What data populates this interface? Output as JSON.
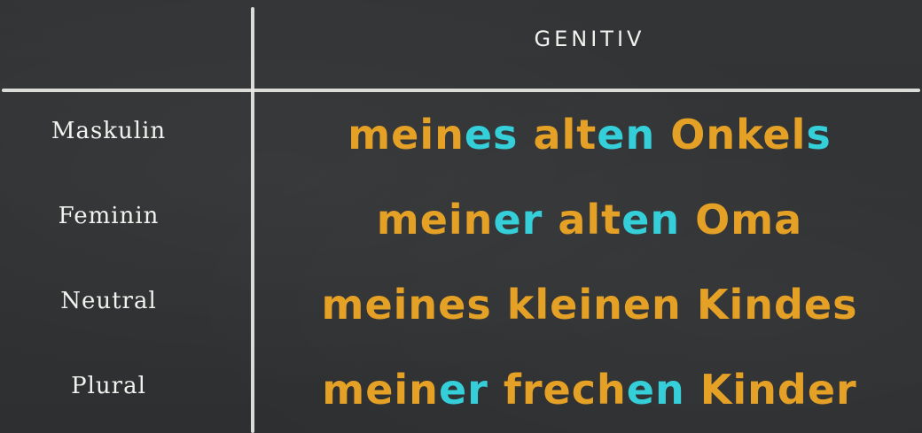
{
  "table": {
    "header": "GENITIV",
    "rows": [
      {
        "label": "Maskulin",
        "words": [
          {
            "stem": "mein",
            "ending": "es"
          },
          {
            "stem": "alt",
            "ending": "en"
          },
          {
            "stem": "Onkel",
            "ending": "s"
          }
        ]
      },
      {
        "label": "Feminin",
        "words": [
          {
            "stem": "mein",
            "ending": "er"
          },
          {
            "stem": "alt",
            "ending": "en"
          },
          {
            "stem": "Oma",
            "ending": ""
          }
        ]
      },
      {
        "label": "Neutral",
        "words": [
          {
            "stem": "meines",
            "ending": ""
          },
          {
            "stem": "kleinen",
            "ending": ""
          },
          {
            "stem": "Kindes",
            "ending": ""
          }
        ]
      },
      {
        "label": "Plural",
        "words": [
          {
            "stem": "mein",
            "ending": "er"
          },
          {
            "stem": "frech",
            "ending": "en"
          },
          {
            "stem": "Kinder",
            "ending": ""
          }
        ]
      }
    ]
  },
  "colors": {
    "stem": "#e5a126",
    "ending": "#34cfd9",
    "chalk": "#f1f1ee",
    "board": "#2f3133"
  }
}
